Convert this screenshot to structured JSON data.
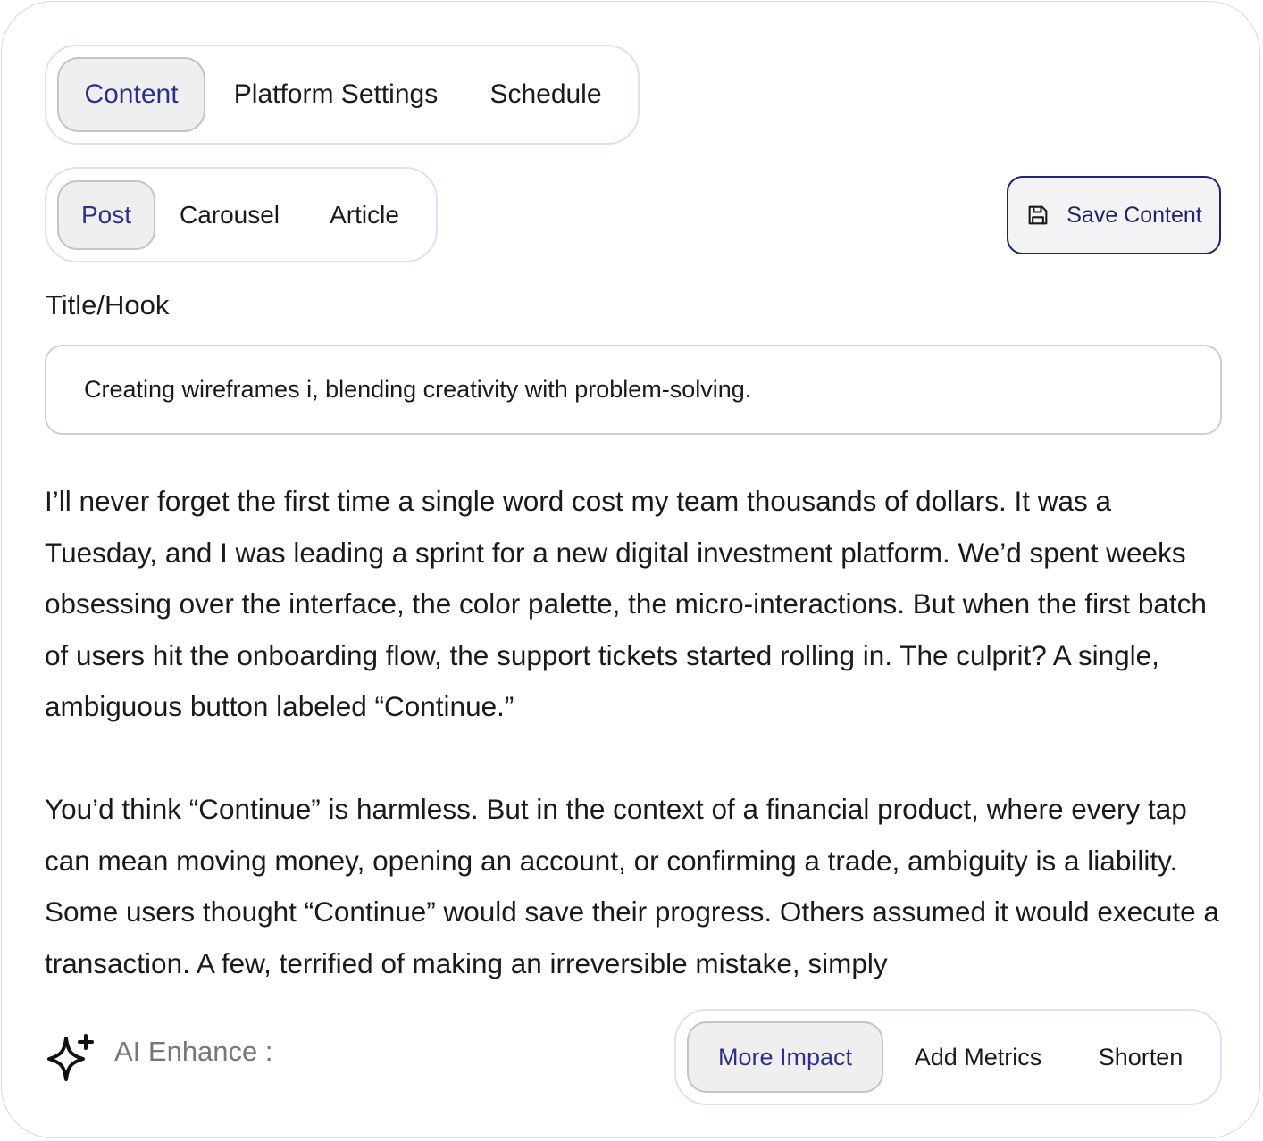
{
  "tabs": {
    "main": [
      "Content",
      "Platform Settings",
      "Schedule"
    ],
    "main_active": "Content",
    "type": [
      "Post",
      "Carousel",
      "Article"
    ],
    "type_active": "Post"
  },
  "toolbar": {
    "save_label": "Save Content",
    "save_icon": "floppy-disk-icon"
  },
  "title_field": {
    "label": "Title/Hook",
    "value": "Creating wireframes i, blending creativity with problem-solving."
  },
  "body": {
    "paragraphs": [
      "I’ll never forget the first time a single word cost my team thousands of dollars. It was a Tuesday, and I was leading a sprint for a new digital investment platform. We’d spent weeks obsessing over the interface, the color palette, the micro-interactions. But when the first batch of users hit the onboarding flow, the support tickets started rolling in. The culprit? A single, ambiguous button labeled “Continue.”",
      "You’d think “Continue” is harmless. But in the context of a financial product, where every tap can mean moving money, opening an account, or confirming a trade, ambiguity is a liability. Some users thought “Continue” would save their progress. Others assumed it would execute a transaction. A few, terrified of making an irreversible mistake, simply"
    ]
  },
  "ai": {
    "icon": "sparkles-icon",
    "label": "AI Enhance :",
    "options": [
      "More Impact",
      "Add Metrics",
      "Shorten"
    ],
    "active": "More Impact"
  },
  "colors": {
    "accent": "#2e2f8c",
    "save_border": "#1e2270",
    "segment_border": "#dbe2f4",
    "active_fill": "#efefef"
  }
}
